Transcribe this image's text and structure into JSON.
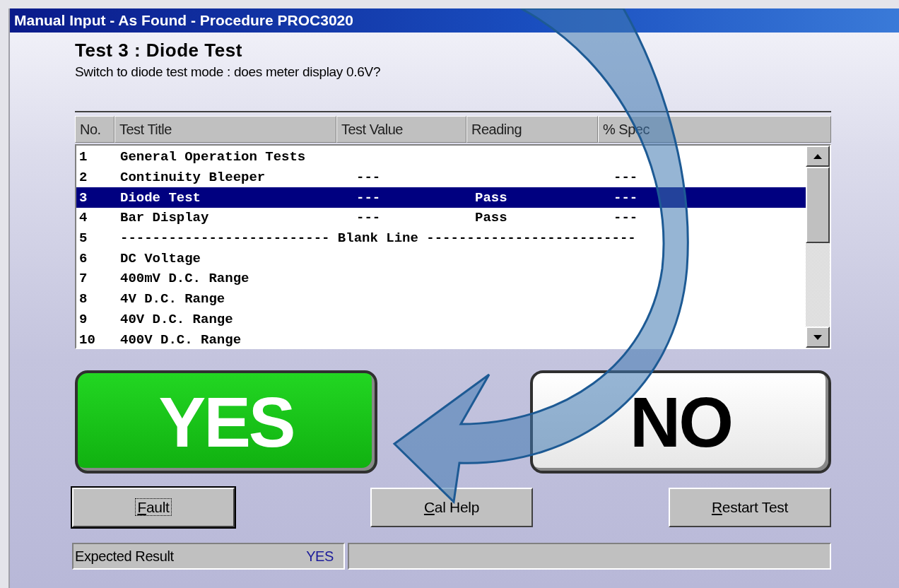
{
  "window": {
    "title": "Manual Input - As Found - Procedure PROC3020"
  },
  "test": {
    "heading": "Test 3 : Diode Test",
    "question": "Switch to diode test mode : does meter display 0.6V?"
  },
  "table": {
    "columns": [
      "No.",
      "Test Title",
      "Test Value",
      "Reading",
      "% Spec"
    ],
    "rows": [
      {
        "kind": "test",
        "no": "1",
        "title": "General Operation Tests",
        "value": "",
        "reading": "",
        "spec": "",
        "selected": false
      },
      {
        "kind": "test",
        "no": "2",
        "title": "Continuity Bleeper",
        "value": "---",
        "reading": "",
        "spec": "---",
        "selected": false
      },
      {
        "kind": "test",
        "no": "3",
        "title": "Diode Test",
        "value": "---",
        "reading": "Pass",
        "spec": "---",
        "selected": true
      },
      {
        "kind": "test",
        "no": "4",
        "title": "Bar Display",
        "value": "---",
        "reading": "Pass",
        "spec": "---",
        "selected": false
      },
      {
        "kind": "separator",
        "no": "5",
        "title": "-------------------------- Blank Line --------------------------",
        "selected": false
      },
      {
        "kind": "test",
        "no": "6",
        "title": "DC Voltage",
        "value": "",
        "reading": "",
        "spec": "",
        "selected": false
      },
      {
        "kind": "test",
        "no": "7",
        "title": "400mV D.C. Range",
        "value": "",
        "reading": "",
        "spec": "",
        "selected": false
      },
      {
        "kind": "test",
        "no": "8",
        "title": "4V D.C. Range",
        "value": "",
        "reading": "",
        "spec": "",
        "selected": false
      },
      {
        "kind": "test",
        "no": "9",
        "title": "40V D.C. Range",
        "value": "",
        "reading": "",
        "spec": "",
        "selected": false
      },
      {
        "kind": "test",
        "no": "10",
        "title": "400V D.C. Range",
        "value": "",
        "reading": "",
        "spec": "",
        "selected": false
      }
    ]
  },
  "answers": [
    {
      "kind": "yes",
      "label": "YES"
    },
    {
      "kind": "no",
      "label": "NO"
    }
  ],
  "buttons": [
    {
      "label": "Fault",
      "focused": true
    },
    {
      "label": "Cal Help",
      "focused": false
    },
    {
      "label": "Restart Test",
      "focused": false
    }
  ],
  "status_bar": {
    "label": "Expected Result",
    "value": "YES"
  }
}
